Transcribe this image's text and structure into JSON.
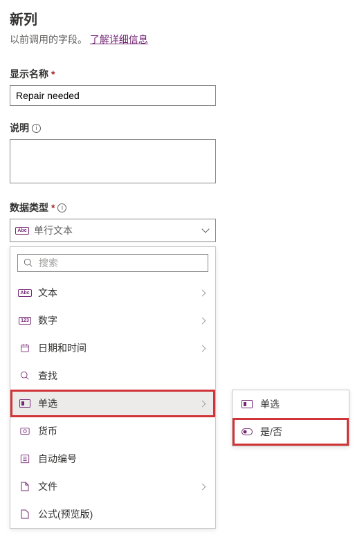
{
  "header": {
    "title": "新列",
    "subtitle": "以前调用的字段。",
    "learn_more": "了解详细信息"
  },
  "fields": {
    "display_name": {
      "label": "显示名称",
      "value": "Repair needed"
    },
    "description": {
      "label": "说明"
    },
    "data_type": {
      "label": "数据类型",
      "selected": "单行文本"
    }
  },
  "dropdown": {
    "search_placeholder": "搜索",
    "options": {
      "text": "文本",
      "number": "数字",
      "datetime": "日期和时间",
      "lookup": "查找",
      "choice": "单选",
      "currency": "货币",
      "autonumber": "自动编号",
      "file": "文件",
      "formula": "公式(预览版)"
    }
  },
  "submenu": {
    "choice": "单选",
    "yesno": "是/否"
  }
}
